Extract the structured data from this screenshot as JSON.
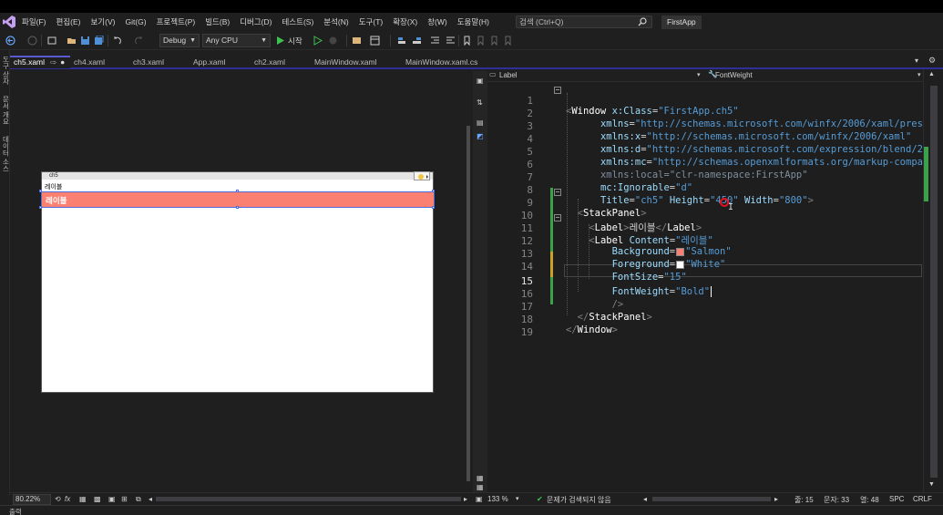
{
  "menu": {
    "items": [
      "파일(F)",
      "편집(E)",
      "보기(V)",
      "Git(G)",
      "프로젝트(P)",
      "빌드(B)",
      "디버그(D)",
      "테스트(S)",
      "분석(N)",
      "도구(T)",
      "확장(X)",
      "창(W)",
      "도움말(H)"
    ],
    "search_placeholder": "검색 (Ctrl+Q)",
    "solution_name": "FirstApp"
  },
  "toolbar": {
    "configuration": "Debug",
    "platform": "Any CPU",
    "start_label": "시작"
  },
  "left_strip": {
    "items": [
      "도구 상자",
      "문서 개요",
      "데이터 소스"
    ]
  },
  "tabs": [
    {
      "label": "ch5.xaml",
      "active": true
    },
    {
      "label": "ch4.xaml",
      "active": false
    },
    {
      "label": "ch3.xaml",
      "active": false
    },
    {
      "label": "App.xaml",
      "active": false
    },
    {
      "label": "ch2.xaml",
      "active": false
    },
    {
      "label": "MainWindow.xaml",
      "active": false
    },
    {
      "label": "MainWindow.xaml.cs",
      "active": false
    }
  ],
  "designer": {
    "window_title": "ch5",
    "label1": "레이블",
    "label2": "레이블",
    "zoom": "80.22%",
    "fx": "fx"
  },
  "navbar": {
    "element": "Label",
    "property": "FontWeight"
  },
  "code": {
    "lines": [
      {
        "n": "1"
      },
      {
        "n": "2"
      },
      {
        "n": "3"
      },
      {
        "n": "4"
      },
      {
        "n": "5"
      },
      {
        "n": "6"
      },
      {
        "n": "7"
      },
      {
        "n": "8"
      },
      {
        "n": "9"
      },
      {
        "n": "10"
      },
      {
        "n": "11"
      },
      {
        "n": "12"
      },
      {
        "n": "13"
      },
      {
        "n": "14"
      },
      {
        "n": "15"
      },
      {
        "n": "16"
      },
      {
        "n": "17"
      },
      {
        "n": "18"
      },
      {
        "n": "19"
      }
    ],
    "l1_el": "Window",
    "l1_attr": "x:Class",
    "l1_val": "\"FirstApp.ch5\"",
    "l2_attr": "xmlns",
    "l2_val": "\"http://schemas.microsoft.com/winfx/2006/xaml/presentatio",
    "l3_attr": "xmlns:x",
    "l3_val": "\"http://schemas.microsoft.com/winfx/2006/xaml\"",
    "l4_attr": "xmlns:d",
    "l4_val": "\"http://schemas.microsoft.com/expression/blend/2008\"",
    "l5_attr": "xmlns:mc",
    "l5_val": "\"http://schemas.openxmlformats.org/markup-compatibili",
    "l6_attr": "xmlns:local",
    "l6_val": "\"clr-namespace:FirstApp\"",
    "l7_attr": "mc:Ignorable",
    "l7_val": "\"d\"",
    "l8_a1": "Title",
    "l8_v1": "\"ch5\"",
    "l8_a2": "Height",
    "l8_v2": "\"450\"",
    "l8_a3": "Width",
    "l8_v3": "\"800\"",
    "l9_el": "StackPanel",
    "l10_el": "Label",
    "l10_txt": "레이블",
    "l10_close": "Label",
    "l11_el": "Label",
    "l11_attr": "Content",
    "l11_val": "\"레이블\"",
    "l12_attr": "Background",
    "l12_val": "\"Salmon\"",
    "l13_attr": "Foreground",
    "l13_val": "\"White\"",
    "l14_attr": "FontSize",
    "l14_val": "\"15\"",
    "l15_attr": "FontWeight",
    "l15_val": "\"Bold\"",
    "l16_txt": "/>",
    "l17_el": "StackPanel",
    "l18_el": "Window",
    "colors": {
      "salmon": "#fa8072",
      "white": "#ffffff"
    }
  },
  "status": {
    "zoom": "133 %",
    "problems": "문제가 검색되지 않음",
    "line": "줄: 15",
    "char": "문자: 33",
    "col": "열: 48",
    "spc": "SPC",
    "eol": "CRLF"
  },
  "bottom_panel": {
    "label": "출력"
  }
}
